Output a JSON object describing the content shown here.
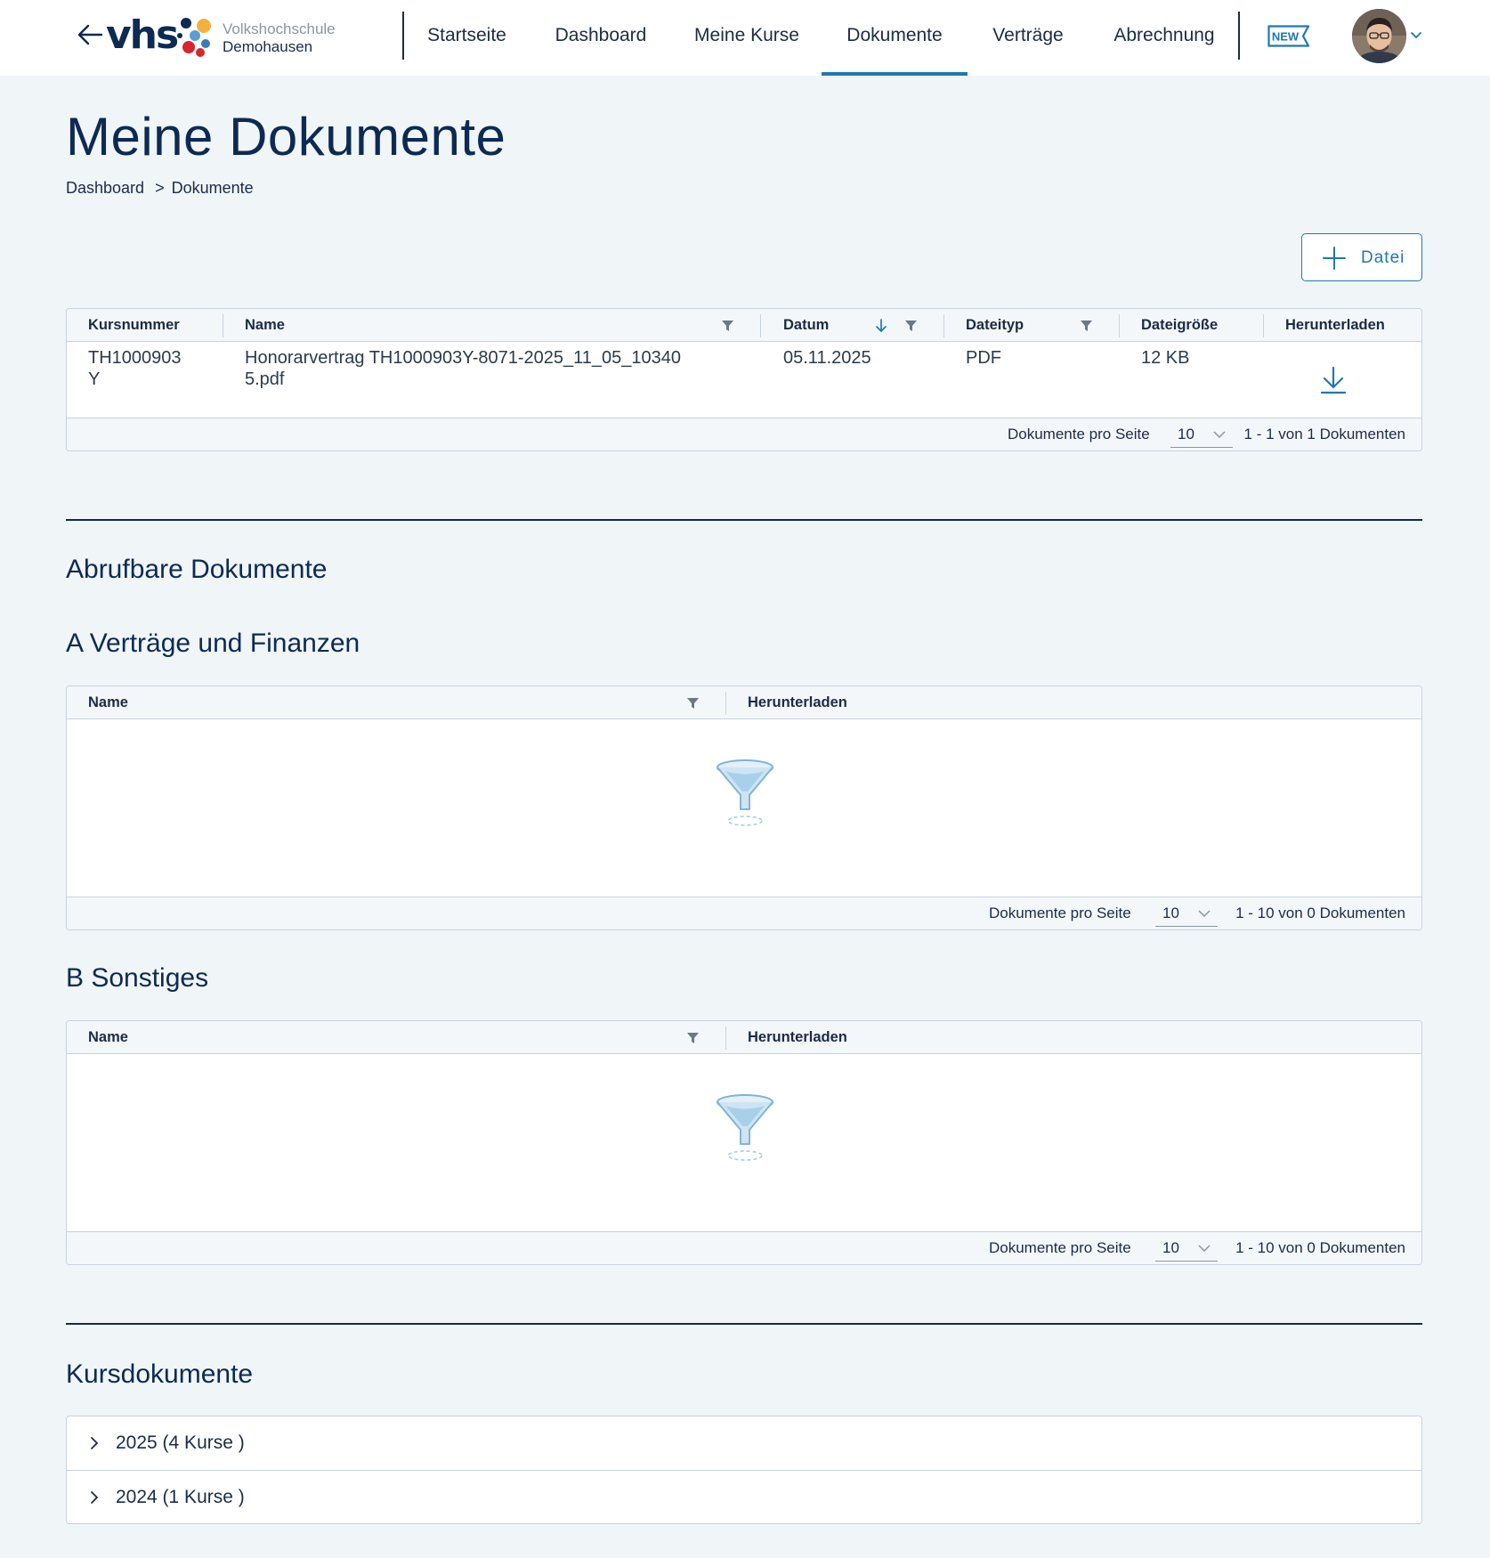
{
  "header": {
    "logo_text": "vhs",
    "logo_line1": "Volkshochschule",
    "logo_line2": "Demohausen",
    "nav": [
      {
        "label": "Startseite"
      },
      {
        "label": "Dashboard"
      },
      {
        "label": "Meine Kurse"
      },
      {
        "label": "Dokumente",
        "active": true
      },
      {
        "label": "Verträge"
      },
      {
        "label": "Abrechnung"
      }
    ],
    "new_badge": "NEW",
    "icons": [
      "arrow-left-icon",
      "new-badge-icon",
      "avatar",
      "chevron-down-icon"
    ]
  },
  "page": {
    "title": "Meine Dokumente",
    "breadcrumb": [
      {
        "label": "Dashboard"
      },
      {
        "label": "Dokumente"
      }
    ],
    "breadcrumb_sep": ">",
    "add_file_label": "Datei"
  },
  "my_documents": {
    "columns": {
      "kursnummer": "Kursnummer",
      "name": "Name",
      "datum": "Datum",
      "dateityp": "Dateityp",
      "dateigroesse": "Dateigröße",
      "herunterladen": "Herunterladen"
    },
    "rows": [
      {
        "kursnummer_line1": "TH1000903",
        "kursnummer_line2": "Y",
        "name_line1": "Honorarvertrag TH1000903Y-8071-2025_11_05_10340",
        "name_line2": "5.pdf",
        "datum": "05.11.2025",
        "dateityp": "PDF",
        "dateigroesse": "12 KB"
      }
    ],
    "pager": {
      "label": "Dokumente pro Seite",
      "page_size": "10",
      "count": "1 - 1 von 1 Dokumenten"
    }
  },
  "available": {
    "heading": "Abrufbare Dokumente",
    "groups": [
      {
        "title": "A Verträge und Finanzen",
        "col_name": "Name",
        "col_download": "Herunterladen",
        "pager": {
          "label": "Dokumente pro Seite",
          "page_size": "10",
          "count": "1 - 10 von 0 Dokumenten"
        }
      },
      {
        "title": "B Sonstiges",
        "col_name": "Name",
        "col_download": "Herunterladen",
        "pager": {
          "label": "Dokumente pro Seite",
          "page_size": "10",
          "count": "1 - 10 von 0 Dokumenten"
        }
      }
    ]
  },
  "course_documents": {
    "heading": "Kursdokumente",
    "years": [
      {
        "label": "2025 (4 Kurse )"
      },
      {
        "label": "2024 (1 Kurse )"
      }
    ]
  },
  "colors": {
    "brand_navy": "#0d2a52",
    "accent_blue": "#1d78b5",
    "page_bg": "#f0f5f8"
  }
}
